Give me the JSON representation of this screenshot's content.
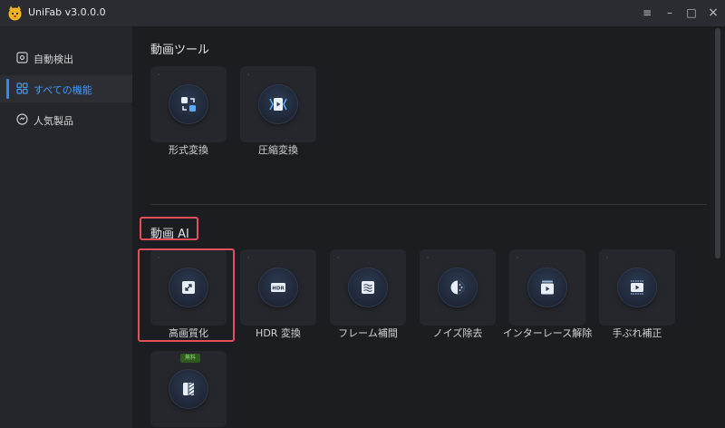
{
  "app": {
    "title": "UniFab v3.0.0.0"
  },
  "window_controls": {
    "menu": "≡",
    "minimize": "–",
    "maximize": "□",
    "close": "×"
  },
  "sidebar": {
    "items": [
      {
        "label": "自動検出",
        "icon": "auto-detect-icon",
        "active": false
      },
      {
        "label": "すべての機能",
        "icon": "grid-icon",
        "active": true
      },
      {
        "label": "人気製品",
        "icon": "popular-icon",
        "active": false
      }
    ]
  },
  "sections": {
    "video_tools": {
      "title": "動画ツール",
      "cards": [
        {
          "label": "形式変換",
          "icon": "convert-icon"
        },
        {
          "label": "圧縮変換",
          "icon": "compress-icon"
        }
      ]
    },
    "video_ai": {
      "title": "動画 AI",
      "cards": [
        {
          "label": "高画質化",
          "icon": "upscale-icon"
        },
        {
          "label": "HDR 変換",
          "icon": "hdr-icon"
        },
        {
          "label": "フレーム補間",
          "icon": "frame-interpolation-icon"
        },
        {
          "label": "ノイズ除去",
          "icon": "denoise-icon"
        },
        {
          "label": "インターレース解除",
          "icon": "deinterlace-icon"
        },
        {
          "label": "手ぶれ補正",
          "icon": "stabilize-icon"
        },
        {
          "label": "",
          "icon": "split-icon",
          "badge": "無料"
        }
      ]
    }
  },
  "colors": {
    "accent": "#2a8cff",
    "highlight": "#e2505e",
    "badge_bg": "#2e5a22",
    "badge_text": "#8fdd6f"
  }
}
